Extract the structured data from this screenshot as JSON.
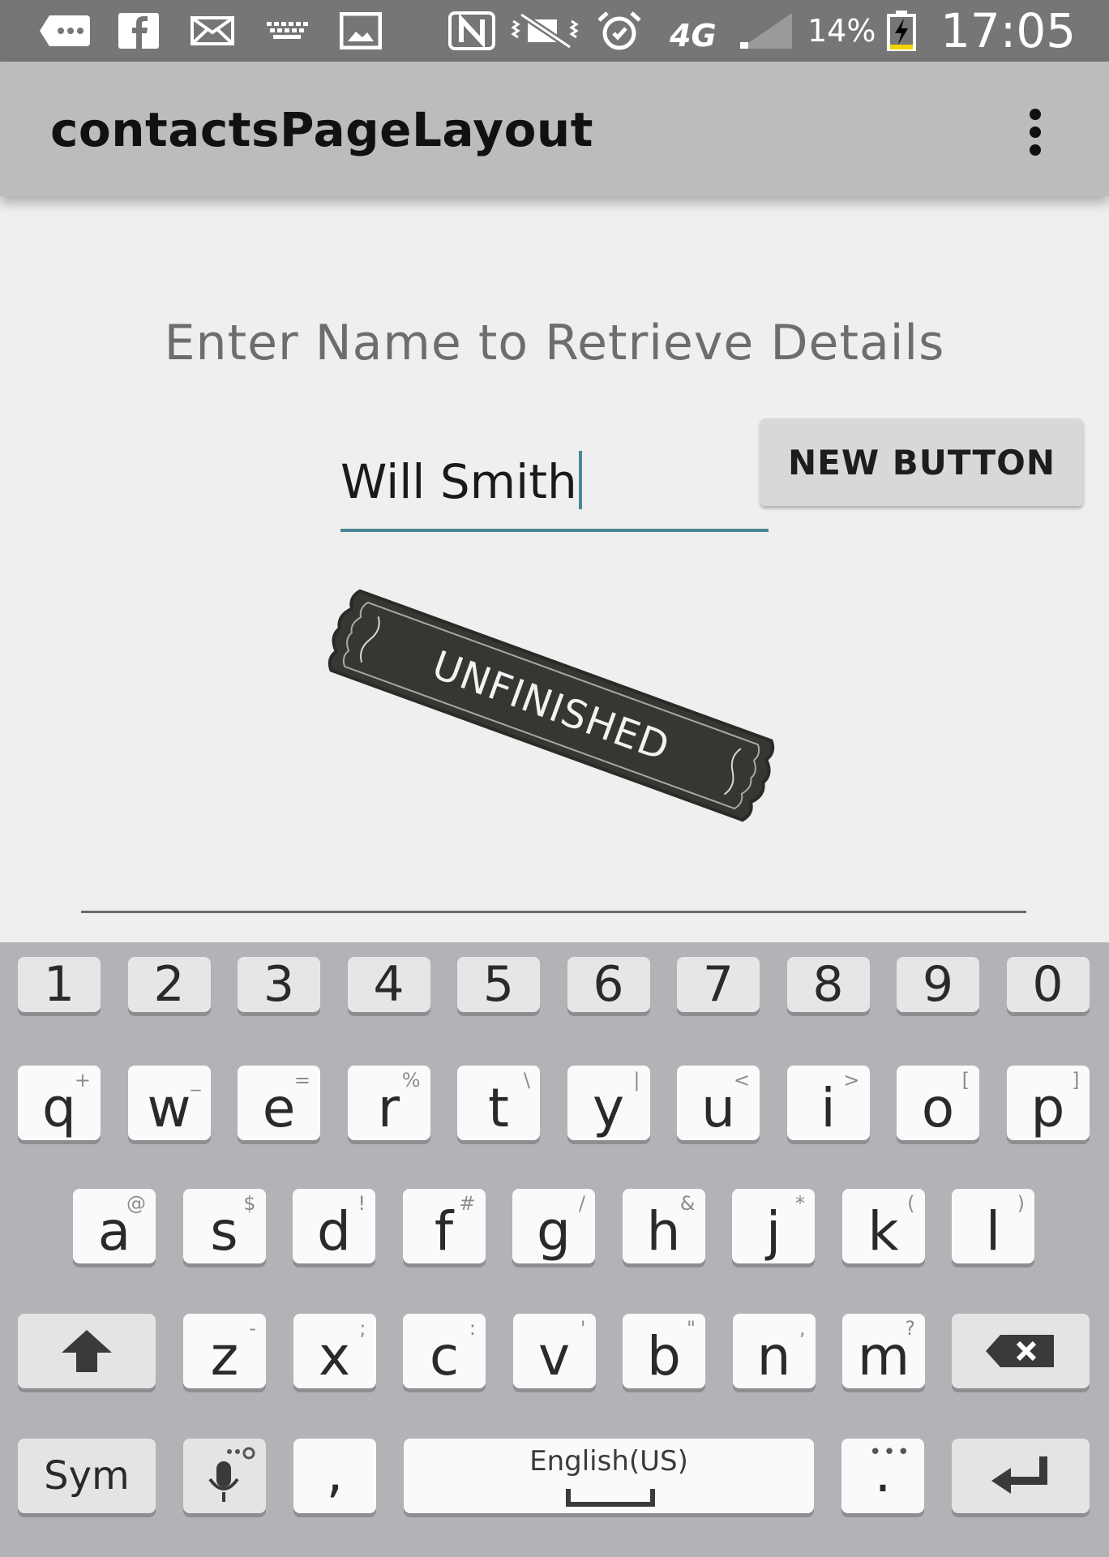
{
  "status_bar": {
    "icons": [
      "chat-notification-icon",
      "facebook-icon",
      "email-icon",
      "keyboard-icon",
      "image-icon",
      "nfc-icon",
      "vibrate-icon",
      "alarm-icon",
      "4g-icon",
      "signal-icon",
      "battery-charging-icon"
    ],
    "network_label": "4G",
    "battery_percent": "14%",
    "battery_level": 0.14,
    "time": "17:05"
  },
  "app_bar": {
    "title": "contactsPageLayout"
  },
  "content": {
    "prompt": "Enter Name to Retrieve Details",
    "name_input_value": "Will Smith",
    "new_button_label": "NEW BUTTON",
    "stamp_text": "UNFINISHED"
  },
  "keyboard": {
    "number_row": [
      "1",
      "2",
      "3",
      "4",
      "5",
      "6",
      "7",
      "8",
      "9",
      "0"
    ],
    "row1": [
      {
        "key": "q",
        "hint": "+"
      },
      {
        "key": "w",
        "hint": "_"
      },
      {
        "key": "e",
        "hint": "="
      },
      {
        "key": "r",
        "hint": "%"
      },
      {
        "key": "t",
        "hint": "\\"
      },
      {
        "key": "y",
        "hint": "|"
      },
      {
        "key": "u",
        "hint": "<"
      },
      {
        "key": "i",
        "hint": ">"
      },
      {
        "key": "o",
        "hint": "["
      },
      {
        "key": "p",
        "hint": "]"
      }
    ],
    "row2": [
      {
        "key": "a",
        "hint": "@"
      },
      {
        "key": "s",
        "hint": "$"
      },
      {
        "key": "d",
        "hint": "!"
      },
      {
        "key": "f",
        "hint": "#"
      },
      {
        "key": "g",
        "hint": "/"
      },
      {
        "key": "h",
        "hint": "&"
      },
      {
        "key": "j",
        "hint": "*"
      },
      {
        "key": "k",
        "hint": "("
      },
      {
        "key": "l",
        "hint": ")"
      }
    ],
    "row3": [
      {
        "key": "z",
        "hint": "-"
      },
      {
        "key": "x",
        "hint": ";"
      },
      {
        "key": "c",
        "hint": ":"
      },
      {
        "key": "v",
        "hint": "'"
      },
      {
        "key": "b",
        "hint": "\""
      },
      {
        "key": "n",
        "hint": ","
      },
      {
        "key": "m",
        "hint": "?"
      }
    ],
    "sym_label": "Sym",
    "comma_label": ",",
    "space_label": "English(US)",
    "period_label": "."
  }
}
